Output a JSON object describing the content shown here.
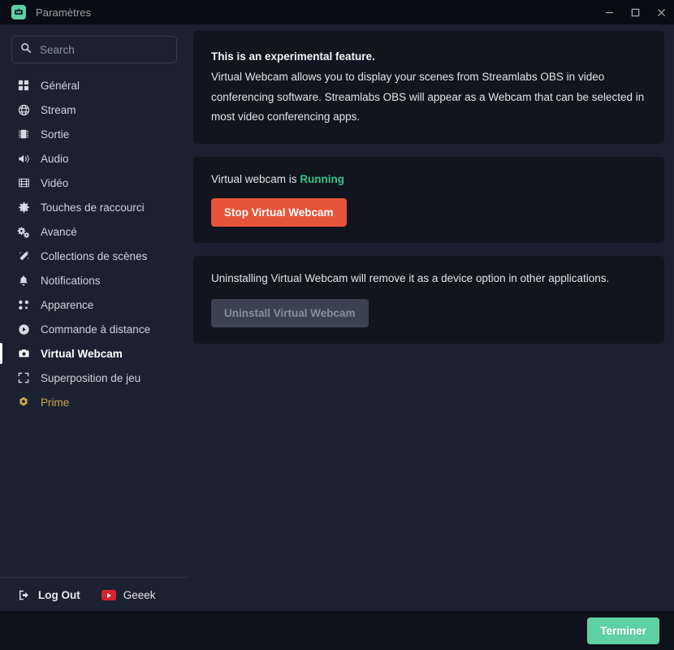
{
  "window": {
    "title": "Paramètres",
    "app_icon": "streamlabs-logo-icon",
    "controls": {
      "minimize": "minimize-icon",
      "maximize": "maximize-icon",
      "close": "close-icon"
    }
  },
  "sidebar": {
    "search": {
      "placeholder": "Search",
      "value": "",
      "icon": "search-icon"
    },
    "items": [
      {
        "label": "Général",
        "icon": "grid-icon",
        "state": "normal"
      },
      {
        "label": "Stream",
        "icon": "globe-icon",
        "state": "normal"
      },
      {
        "label": "Sortie",
        "icon": "chip-icon",
        "state": "normal"
      },
      {
        "label": "Audio",
        "icon": "speaker-icon",
        "state": "normal"
      },
      {
        "label": "Vidéo",
        "icon": "film-icon",
        "state": "normal"
      },
      {
        "label": "Touches de raccourci",
        "icon": "gear-icon",
        "state": "normal"
      },
      {
        "label": "Avancé",
        "icon": "gears-icon",
        "state": "normal"
      },
      {
        "label": "Collections de scènes",
        "icon": "magic-wand-icon",
        "state": "normal"
      },
      {
        "label": "Notifications",
        "icon": "bell-icon",
        "state": "normal"
      },
      {
        "label": "Apparence",
        "icon": "dots-icon",
        "state": "normal"
      },
      {
        "label": "Commande à distance",
        "icon": "play-circle-icon",
        "state": "normal"
      },
      {
        "label": "Virtual Webcam",
        "icon": "camera-icon",
        "state": "active"
      },
      {
        "label": "Superposition de jeu",
        "icon": "expand-icon",
        "state": "normal"
      },
      {
        "label": "Prime",
        "icon": "prime-badge-icon",
        "state": "prime"
      }
    ],
    "footer": {
      "logout_label": "Log Out",
      "logout_icon": "logout-icon",
      "account_name": "Geeek",
      "account_icon": "youtube-icon"
    }
  },
  "main": {
    "info_card": {
      "headline": "This is an experimental feature.",
      "body": "Virtual Webcam allows you to display your scenes from Streamlabs OBS in video conferencing software. Streamlabs OBS will appear as a Webcam that can be selected in most video conferencing apps."
    },
    "status_card": {
      "prefix": "Virtual webcam is",
      "status": "Running",
      "status_color": "#34c48a",
      "action_label": "Stop Virtual Webcam",
      "action_color": "#e8543a"
    },
    "uninstall_card": {
      "description": "Uninstalling Virtual Webcam will remove it as a device option in other applications.",
      "action_label": "Uninstall Virtual Webcam",
      "action_disabled": true
    }
  },
  "bottom_bar": {
    "done_label": "Terminer",
    "done_color": "#5fd0a4"
  }
}
